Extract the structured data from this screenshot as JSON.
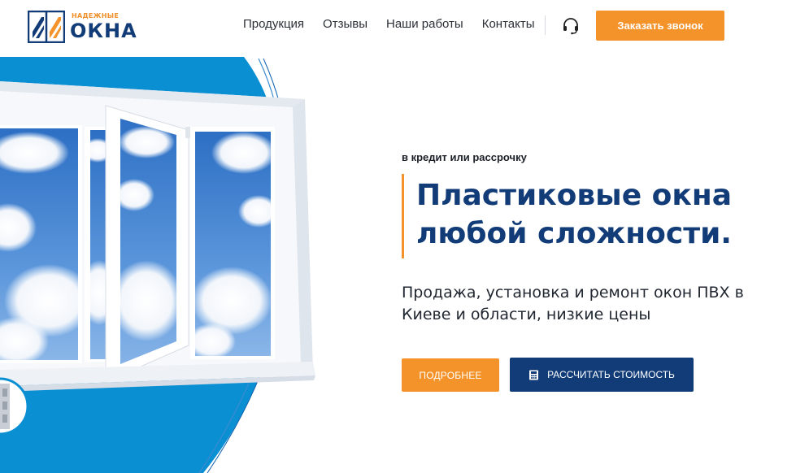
{
  "brand": {
    "small_text": "НАДЕЖНЫЕ",
    "big_text": "ОКНА",
    "colors": {
      "navy": "#123c78",
      "orange": "#f4932a",
      "blue_accent": "#0b8fd3"
    }
  },
  "nav": {
    "items": [
      {
        "label": "Продукция"
      },
      {
        "label": "Отзывы"
      },
      {
        "label": "Наши работы"
      },
      {
        "label": "Контакты"
      }
    ],
    "support_icon": "headset-icon",
    "call_button_label": "Заказать звонок"
  },
  "hero": {
    "kicker": "в кредит или рассрочку",
    "title_line1": "Пластиковые окна",
    "title_line2": "любой сложности.",
    "subtitle": "Продажа, установка и ремонт окон ПВХ в Киеве и области, низкие цены",
    "more_button_label": "ПОДРОБНЕЕ",
    "calc_button_label": "РАССЧИТАТЬ СТОИМОСТЬ",
    "calc_icon": "calculator-icon"
  }
}
